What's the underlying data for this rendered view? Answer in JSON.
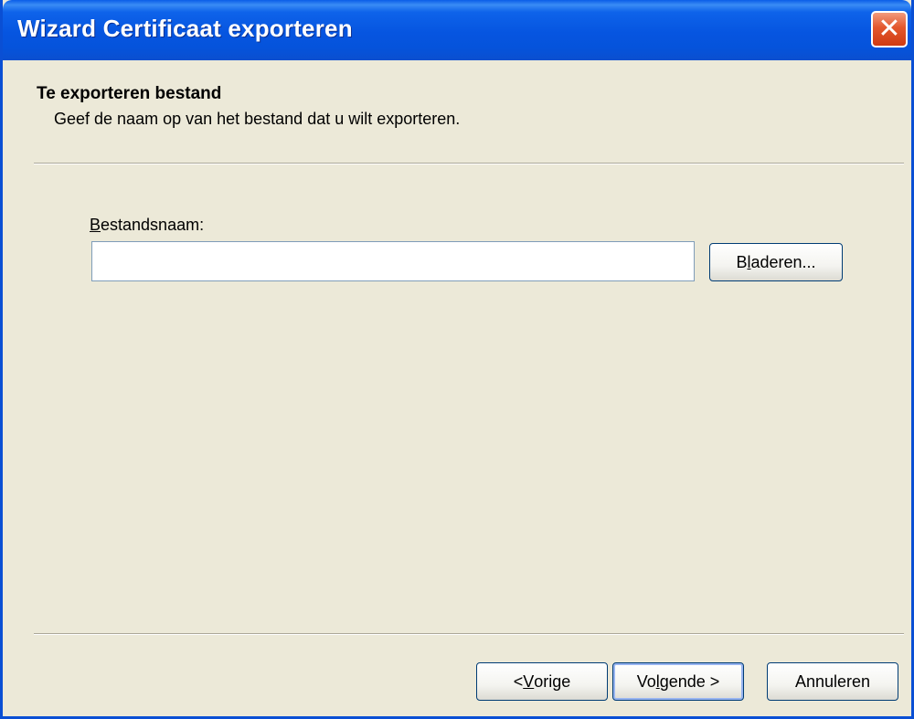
{
  "window": {
    "title": "Wizard Certificaat exporteren",
    "close_glyph": "✕"
  },
  "header": {
    "title": "Te exporteren bestand",
    "subtitle": "Geef de naam op van het bestand dat u wilt exporteren."
  },
  "form": {
    "filename_label_accel": "B",
    "filename_label_rest": "estandsnaam:",
    "filename_value": "",
    "browse_pre": "B",
    "browse_accel": "l",
    "browse_rest": "aderen..."
  },
  "buttons": {
    "back_pre": "< ",
    "back_accel": "V",
    "back_rest": "orige",
    "next_pre": "Vo",
    "next_accel": "l",
    "next_rest": "gende >",
    "cancel": "Annuleren"
  },
  "colors": {
    "titlebar": "#0655e0",
    "dialog_bg": "#ece9d8",
    "close_button": "#e3572d"
  },
  "icons": {
    "close": "close-icon"
  }
}
